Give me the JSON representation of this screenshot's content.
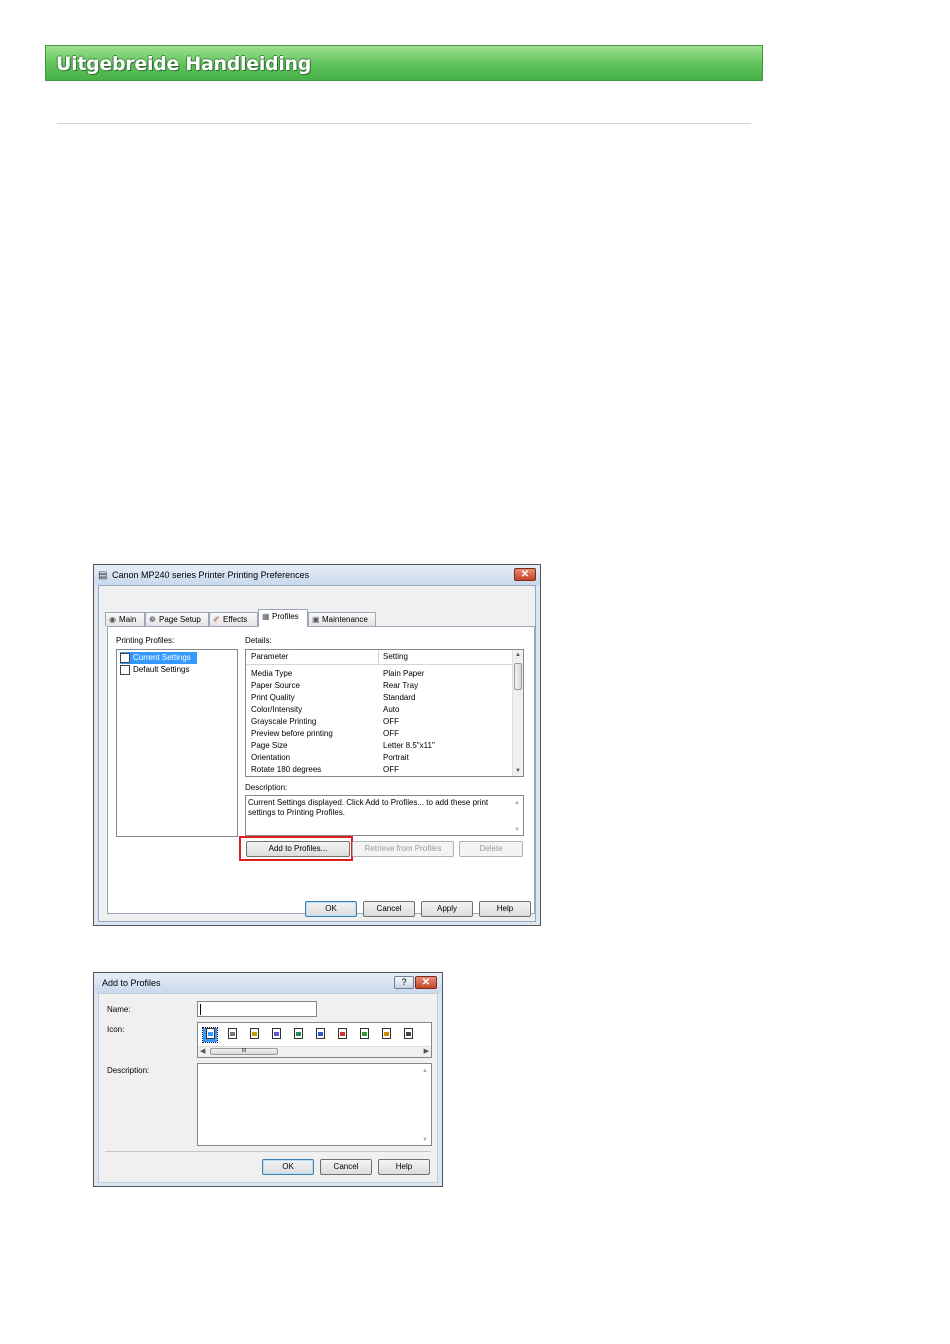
{
  "header": {
    "title": "Uitgebreide Handleiding"
  },
  "prefs_dialog": {
    "title": "Canon MP240 series Printer Printing Preferences",
    "tabs": [
      "Main",
      "Page Setup",
      "Effects",
      "Profiles",
      "Maintenance"
    ],
    "active_tab": "Profiles",
    "printing_profiles_label": "Printing Profiles:",
    "profiles": [
      "Current Settings",
      "Default Settings"
    ],
    "details_label": "Details:",
    "details_columns": [
      "Parameter",
      "Setting"
    ],
    "details_rows": [
      {
        "parameter": "Media Type",
        "setting": "Plain Paper"
      },
      {
        "parameter": "Paper Source",
        "setting": "Rear Tray"
      },
      {
        "parameter": "Print Quality",
        "setting": "Standard"
      },
      {
        "parameter": "Color/Intensity",
        "setting": "Auto"
      },
      {
        "parameter": "Grayscale Printing",
        "setting": "OFF"
      },
      {
        "parameter": "Preview before printing",
        "setting": "OFF"
      },
      {
        "parameter": "Page Size",
        "setting": "Letter 8.5\"x11\""
      },
      {
        "parameter": "Orientation",
        "setting": "Portrait"
      },
      {
        "parameter": "Rotate 180 degrees",
        "setting": "OFF"
      }
    ],
    "description_label": "Description:",
    "description_text": "Current Settings displayed. Click Add to Profiles... to add these print settings to Printing Profiles.",
    "add_button": "Add to Profiles...",
    "retrieve_button": "Retrieve from Profiles",
    "delete_button": "Delete",
    "ok_button": "OK",
    "cancel_button": "Cancel",
    "apply_button": "Apply",
    "help_button": "Help",
    "highlight_color": "#e02020"
  },
  "add_dialog": {
    "title": "Add to Profiles",
    "help_glyph": "?",
    "name_label": "Name:",
    "name_value": "",
    "icon_label": "Icon:",
    "scroll_glyph": "III",
    "description_label": "Description:",
    "description_value": "",
    "ok_button": "OK",
    "cancel_button": "Cancel",
    "help_button": "Help"
  }
}
